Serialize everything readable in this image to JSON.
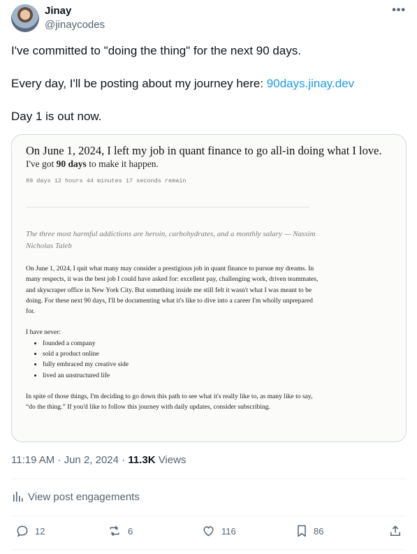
{
  "author": {
    "name": "Jinay",
    "handle": "@jinaycodes"
  },
  "menu_icon": "more-dots-icon",
  "tweet": {
    "line1": "I've committed to \"doing the thing\" for the next 90 days.",
    "line2_prefix": "Every day, I'll be posting about my journey here: ",
    "link_text": "90days.jinay.dev",
    "line3": "Day 1 is out now."
  },
  "card": {
    "title": "On June 1, 2024, I left my job in quant finance to go all-in doing what I love.",
    "subtitle_prefix": "I've got ",
    "subtitle_bold": "90 days",
    "subtitle_suffix": " to make it happen.",
    "countdown": "89 days 12 hours 44 minutes 17 seconds remain",
    "quote": "The three most harmful addictions are heroin, carbohydrates, and a monthly salary — Nassim Nicholas Taleb",
    "paragraph1": "On June 1, 2024, I quit what many may consider a prestigious job in quant finance to pursue my dreams. In many respects, it was the best job I could have asked for: excellent pay, challenging work, driven teammates, and skyscraper office in New York City. But something inside me still felt it wasn't what I was meant to be doing. For these next 90 days, I'll be documenting what it's like to dive into a career I'm wholly unprepared for.",
    "never_heading": "I have never:",
    "never_items": [
      "founded a company",
      "sold a product online",
      "fully embraced my creative side",
      "lived an unstructured life"
    ],
    "paragraph2": "In spite of those things, I'm deciding to go down this path to see what it's really like to, as many like to say, “do the thing.” If you'd like to follow this journey with daily updates, consider subscribing."
  },
  "meta": {
    "time": "11:19 AM · Jun 2, 2024 · ",
    "views_count": "11.3K",
    "views_label": " Views"
  },
  "engagements_label": "View post engagements",
  "actions": {
    "replies": "12",
    "reposts": "6",
    "likes": "116",
    "bookmarks": "86"
  },
  "colors": {
    "link": "#1d9bf0",
    "muted": "#536471",
    "text": "#0f1419",
    "border": "#cfd9de"
  }
}
